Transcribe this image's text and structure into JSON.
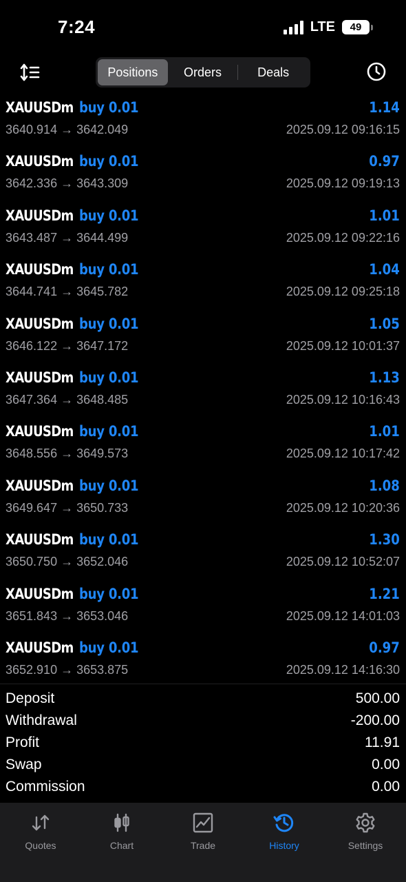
{
  "status_bar": {
    "time": "7:24",
    "network": "LTE",
    "battery": "49"
  },
  "toolbar": {
    "tabs": [
      {
        "label": "Positions",
        "active": true
      },
      {
        "label": "Orders",
        "active": false
      },
      {
        "label": "Deals",
        "active": false
      }
    ],
    "icons": {
      "left": "sort-icon",
      "right": "clock-icon"
    }
  },
  "deals": [
    {
      "symbol": "XAUUSDm",
      "side": "buy 0.01",
      "profit": "1.14",
      "prices": "3640.914 → 3642.049",
      "time": "2025.09.12 09:16:15"
    },
    {
      "symbol": "XAUUSDm",
      "side": "buy 0.01",
      "profit": "0.97",
      "prices": "3642.336 → 3643.309",
      "time": "2025.09.12 09:19:13"
    },
    {
      "symbol": "XAUUSDm",
      "side": "buy 0.01",
      "profit": "1.01",
      "prices": "3643.487 → 3644.499",
      "time": "2025.09.12 09:22:16"
    },
    {
      "symbol": "XAUUSDm",
      "side": "buy 0.01",
      "profit": "1.04",
      "prices": "3644.741 → 3645.782",
      "time": "2025.09.12 09:25:18"
    },
    {
      "symbol": "XAUUSDm",
      "side": "buy 0.01",
      "profit": "1.05",
      "prices": "3646.122 → 3647.172",
      "time": "2025.09.12 10:01:37"
    },
    {
      "symbol": "XAUUSDm",
      "side": "buy 0.01",
      "profit": "1.13",
      "prices": "3647.364 → 3648.485",
      "time": "2025.09.12 10:16:43"
    },
    {
      "symbol": "XAUUSDm",
      "side": "buy 0.01",
      "profit": "1.01",
      "prices": "3648.556 → 3649.573",
      "time": "2025.09.12 10:17:42"
    },
    {
      "symbol": "XAUUSDm",
      "side": "buy 0.01",
      "profit": "1.08",
      "prices": "3649.647 → 3650.733",
      "time": "2025.09.12 10:20:36"
    },
    {
      "symbol": "XAUUSDm",
      "side": "buy 0.01",
      "profit": "1.30",
      "prices": "3650.750 → 3652.046",
      "time": "2025.09.12 10:52:07"
    },
    {
      "symbol": "XAUUSDm",
      "side": "buy 0.01",
      "profit": "1.21",
      "prices": "3651.843 → 3653.046",
      "time": "2025.09.12 14:01:03"
    },
    {
      "symbol": "XAUUSDm",
      "side": "buy 0.01",
      "profit": "0.97",
      "prices": "3652.910 → 3653.875",
      "time": "2025.09.12 14:16:30"
    }
  ],
  "summary": [
    {
      "label": "Deposit",
      "value": "500.00"
    },
    {
      "label": "Withdrawal",
      "value": "-200.00"
    },
    {
      "label": "Profit",
      "value": "11.91"
    },
    {
      "label": "Swap",
      "value": "0.00"
    },
    {
      "label": "Commission",
      "value": "0.00"
    }
  ],
  "tabbar": [
    {
      "label": "Quotes",
      "icon": "quotes-icon",
      "active": false
    },
    {
      "label": "Chart",
      "icon": "chart-icon",
      "active": false
    },
    {
      "label": "Trade",
      "icon": "trade-icon",
      "active": false
    },
    {
      "label": "History",
      "icon": "history-icon",
      "active": true
    },
    {
      "label": "Settings",
      "icon": "settings-icon",
      "active": false
    }
  ],
  "colors": {
    "accent": "#1f86f7",
    "background": "#000000",
    "muted_text": "#a0a0a5",
    "tabbar_bg": "#1c1c1e"
  }
}
